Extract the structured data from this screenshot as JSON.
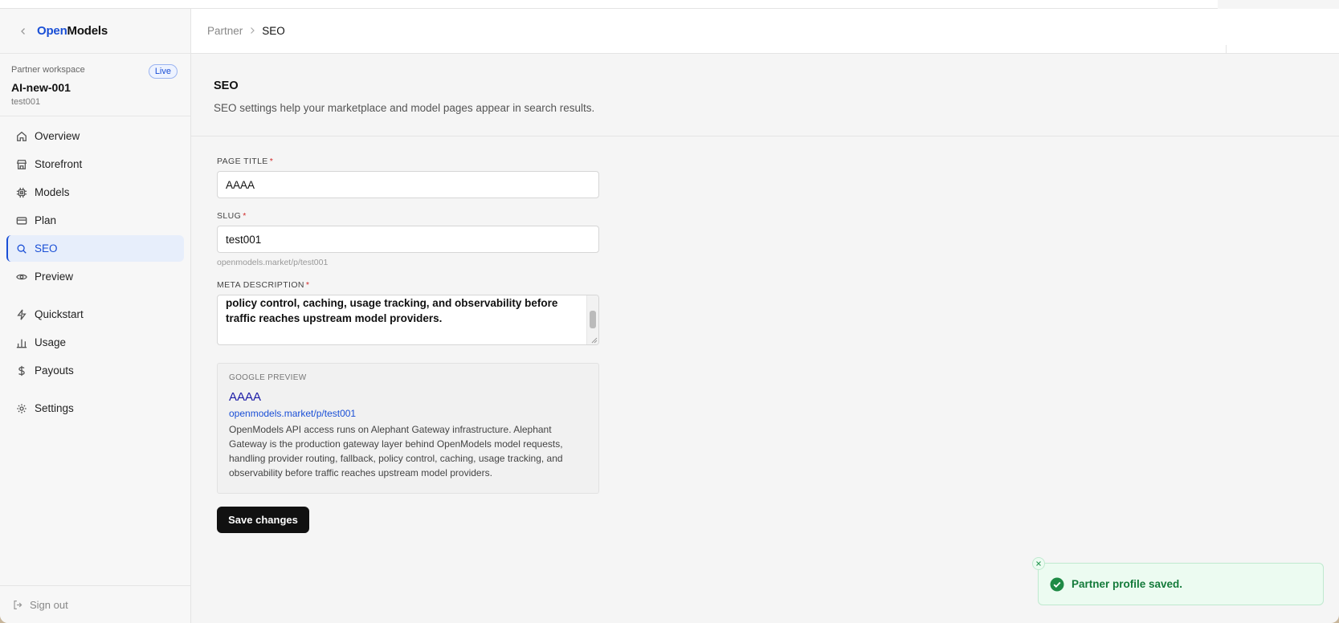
{
  "brand": {
    "part1": "Open",
    "part2": "Models"
  },
  "workspace": {
    "label": "Partner workspace",
    "badge": "Live",
    "name": "AI-new-001",
    "slug": "test001"
  },
  "nav": {
    "items": [
      {
        "label": "Overview",
        "icon": "home-icon"
      },
      {
        "label": "Storefront",
        "icon": "store-icon"
      },
      {
        "label": "Models",
        "icon": "cpu-icon"
      },
      {
        "label": "Plan",
        "icon": "card-icon"
      },
      {
        "label": "SEO",
        "icon": "search-icon",
        "active": true
      },
      {
        "label": "Preview",
        "icon": "eye-icon"
      },
      {
        "label": "Quickstart",
        "icon": "bolt-icon"
      },
      {
        "label": "Usage",
        "icon": "bar-chart-icon"
      },
      {
        "label": "Payouts",
        "icon": "dollar-icon"
      },
      {
        "label": "Settings",
        "icon": "gear-icon"
      }
    ],
    "signout": "Sign out"
  },
  "breadcrumb": {
    "parent": "Partner",
    "current": "SEO"
  },
  "section": {
    "title": "SEO",
    "description": "SEO settings help your marketplace and model pages appear in search results."
  },
  "form": {
    "page_title": {
      "label": "PAGE TITLE",
      "required": "*",
      "value": "AAAA"
    },
    "slug": {
      "label": "SLUG",
      "required": "*",
      "value": "test001",
      "hint": "openmodels.market/p/test001"
    },
    "meta_description": {
      "label": "META DESCRIPTION",
      "required": "*",
      "value": "OpenModels API access runs on Alephant Gateway infrastructure. Alephant Gateway is the production gateway layer behind OpenModels model requests, handling provider routing, fallback, policy control, caching, usage tracking, and observability before traffic reaches upstream model providers."
    }
  },
  "google_preview": {
    "label": "GOOGLE PREVIEW",
    "title": "AAAA",
    "url": "openmodels.market/p/test001",
    "description": "OpenModels API access runs on Alephant Gateway infrastructure. Alephant Gateway is the production gateway layer behind OpenModels model requests, handling provider routing, fallback, policy control, caching, usage tracking, and observability before traffic reaches upstream model providers."
  },
  "save_label": "Save changes",
  "toast": {
    "message": "Partner profile saved."
  },
  "colors": {
    "accent": "#1a4fd6",
    "success": "#137a3a",
    "danger": "#d02a2a"
  }
}
